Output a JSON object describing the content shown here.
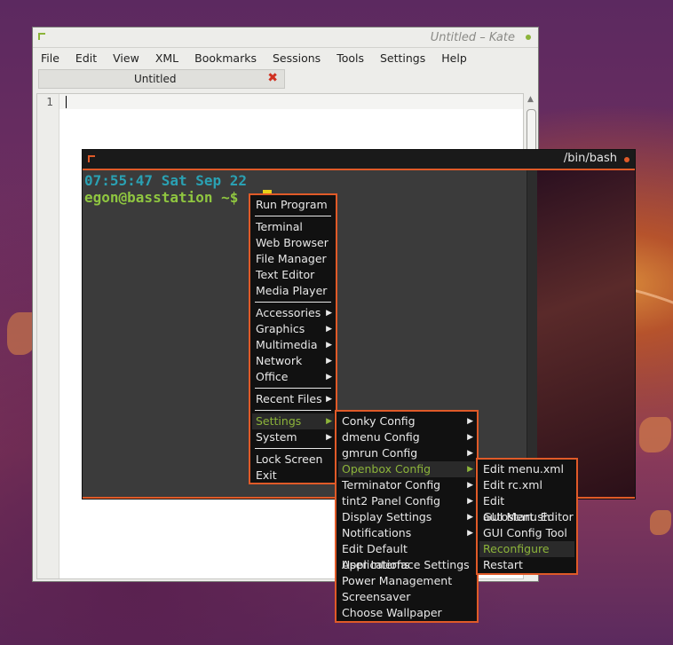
{
  "kate": {
    "title": "Untitled – Kate",
    "menu": [
      "File",
      "Edit",
      "View",
      "XML",
      "Bookmarks",
      "Sessions",
      "Tools",
      "Settings",
      "Help"
    ],
    "tab_label": "Untitled",
    "tab_close": "✖",
    "line_number": "1"
  },
  "terminal": {
    "title": "/bin/bash",
    "clock": "07:55:47 Sat Sep 22",
    "prompt": "egon@basstation ~$"
  },
  "root_menu": {
    "items": [
      {
        "label": "Run Program"
      },
      {
        "sep": true
      },
      {
        "label": "Terminal"
      },
      {
        "label": "Web Browser"
      },
      {
        "label": "File Manager"
      },
      {
        "label": "Text Editor"
      },
      {
        "label": "Media Player"
      },
      {
        "sep": true
      },
      {
        "label": "Accessories",
        "sub": true
      },
      {
        "label": "Graphics",
        "sub": true
      },
      {
        "label": "Multimedia",
        "sub": true
      },
      {
        "label": "Network",
        "sub": true
      },
      {
        "label": "Office",
        "sub": true
      },
      {
        "sep": true
      },
      {
        "label": "Recent Files",
        "sub": true
      },
      {
        "sep": true
      },
      {
        "label": "Settings",
        "sub": true,
        "active": true
      },
      {
        "label": "System",
        "sub": true
      },
      {
        "sep": true
      },
      {
        "label": "Lock Screen"
      },
      {
        "label": "Exit"
      }
    ]
  },
  "settings_menu": {
    "items": [
      {
        "label": "Conky Config",
        "sub": true
      },
      {
        "label": "dmenu Config",
        "sub": true
      },
      {
        "label": "gmrun Config",
        "sub": true
      },
      {
        "label": "Openbox Config",
        "sub": true,
        "active": true
      },
      {
        "label": "Terminator Config",
        "sub": true
      },
      {
        "label": "tint2 Panel Config",
        "sub": true
      },
      {
        "label": "Display Settings",
        "sub": true
      },
      {
        "label": "Notifications",
        "sub": true
      },
      {
        "label": "Edit Default Applications"
      },
      {
        "label": "User Interface Settings"
      },
      {
        "label": "Power Management"
      },
      {
        "label": "Screensaver"
      },
      {
        "label": "Choose Wallpaper"
      }
    ]
  },
  "openbox_menu": {
    "items": [
      {
        "label": "Edit menu.xml"
      },
      {
        "label": "Edit rc.xml"
      },
      {
        "label": "Edit autostart.sh"
      },
      {
        "label": "GUI Menu Editor"
      },
      {
        "label": "GUI Config Tool"
      },
      {
        "label": "Reconfigure",
        "active": true
      },
      {
        "label": "Restart"
      }
    ]
  },
  "colors": {
    "accent": "#e05a28",
    "highlight_text": "#8cb43a",
    "clock": "#2aa1b3",
    "prompt": "#8fc640",
    "cursor": "#e8d11a"
  }
}
